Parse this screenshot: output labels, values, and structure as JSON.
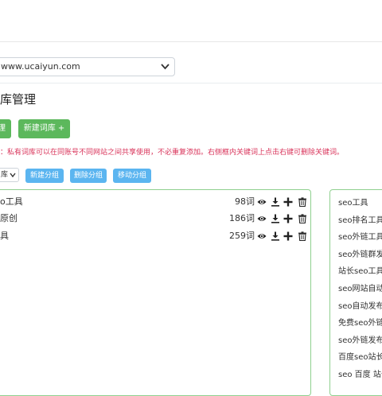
{
  "header": {},
  "site_selector": {
    "value": "www.ucaiyun.com"
  },
  "page": {
    "title": "库管理"
  },
  "buttons": {
    "manage": "理",
    "new_library": "新建词库 +"
  },
  "notice": "：私有词库可以在同账号不同网站之间共享使用，不必重复添加。右侧框内关键词上点击右键可删除关键词。",
  "group_bar": {
    "select_value": "库",
    "new_group": "新建分组",
    "delete_group": "删除分组",
    "move_group": "移动分组"
  },
  "libraries": [
    {
      "name": "o工具",
      "count": "98词"
    },
    {
      "name": "原创",
      "count": "186词"
    },
    {
      "name": "具",
      "count": "259词"
    }
  ],
  "keywords": [
    "seo工具",
    "seo排名工具",
    "seo外链工具",
    "seo外链群发",
    "站长seo工具",
    "seo网站自动",
    "seo自动发布",
    "免费seo外链",
    "seo外链发布",
    "百度seo站长",
    "seo 百度 站长"
  ],
  "icons": {
    "view": "eye-icon",
    "download": "download-icon",
    "add": "plus-icon",
    "delete": "trash-icon",
    "dropdown": "chevron-down-icon"
  }
}
